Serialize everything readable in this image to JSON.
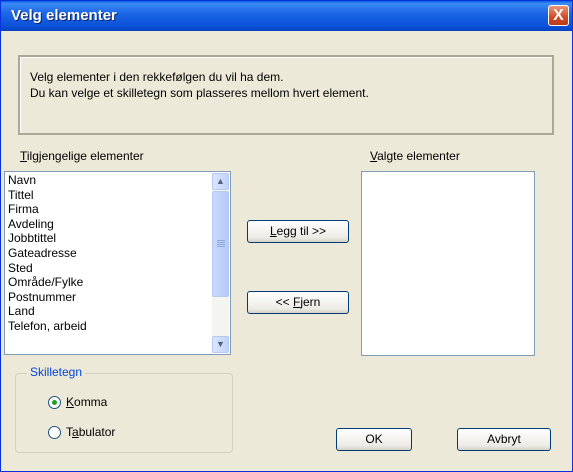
{
  "window": {
    "title": "Velg elementer",
    "close_label": "X"
  },
  "info": {
    "line1": "Velg elementer i den rekkefølgen du vil ha dem.",
    "line2": "Du kan velge et skilletegn som plasseres mellom hvert element."
  },
  "available": {
    "label_first": "T",
    "label_rest": "ilgjengelige elementer",
    "items": [
      "Navn",
      "Tittel",
      "Firma",
      "Avdeling",
      "Jobbtittel",
      "Gateadresse",
      "Sted",
      "Område/Fylke",
      "Postnummer",
      "Land",
      "Telefon, arbeid"
    ]
  },
  "selected": {
    "label_first": "V",
    "label_rest": "algte elementer",
    "items": []
  },
  "buttons": {
    "add_first": "L",
    "add_rest": "egg til >>",
    "remove_pre": "<< ",
    "remove_first": "F",
    "remove_rest": "jern",
    "ok": "OK",
    "cancel": "Avbryt"
  },
  "separator": {
    "title": "Skilletegn",
    "options": [
      {
        "first": "K",
        "rest": "omma",
        "checked": true
      },
      {
        "pre": "T",
        "first": "a",
        "rest": "bulator",
        "checked": false
      }
    ]
  }
}
